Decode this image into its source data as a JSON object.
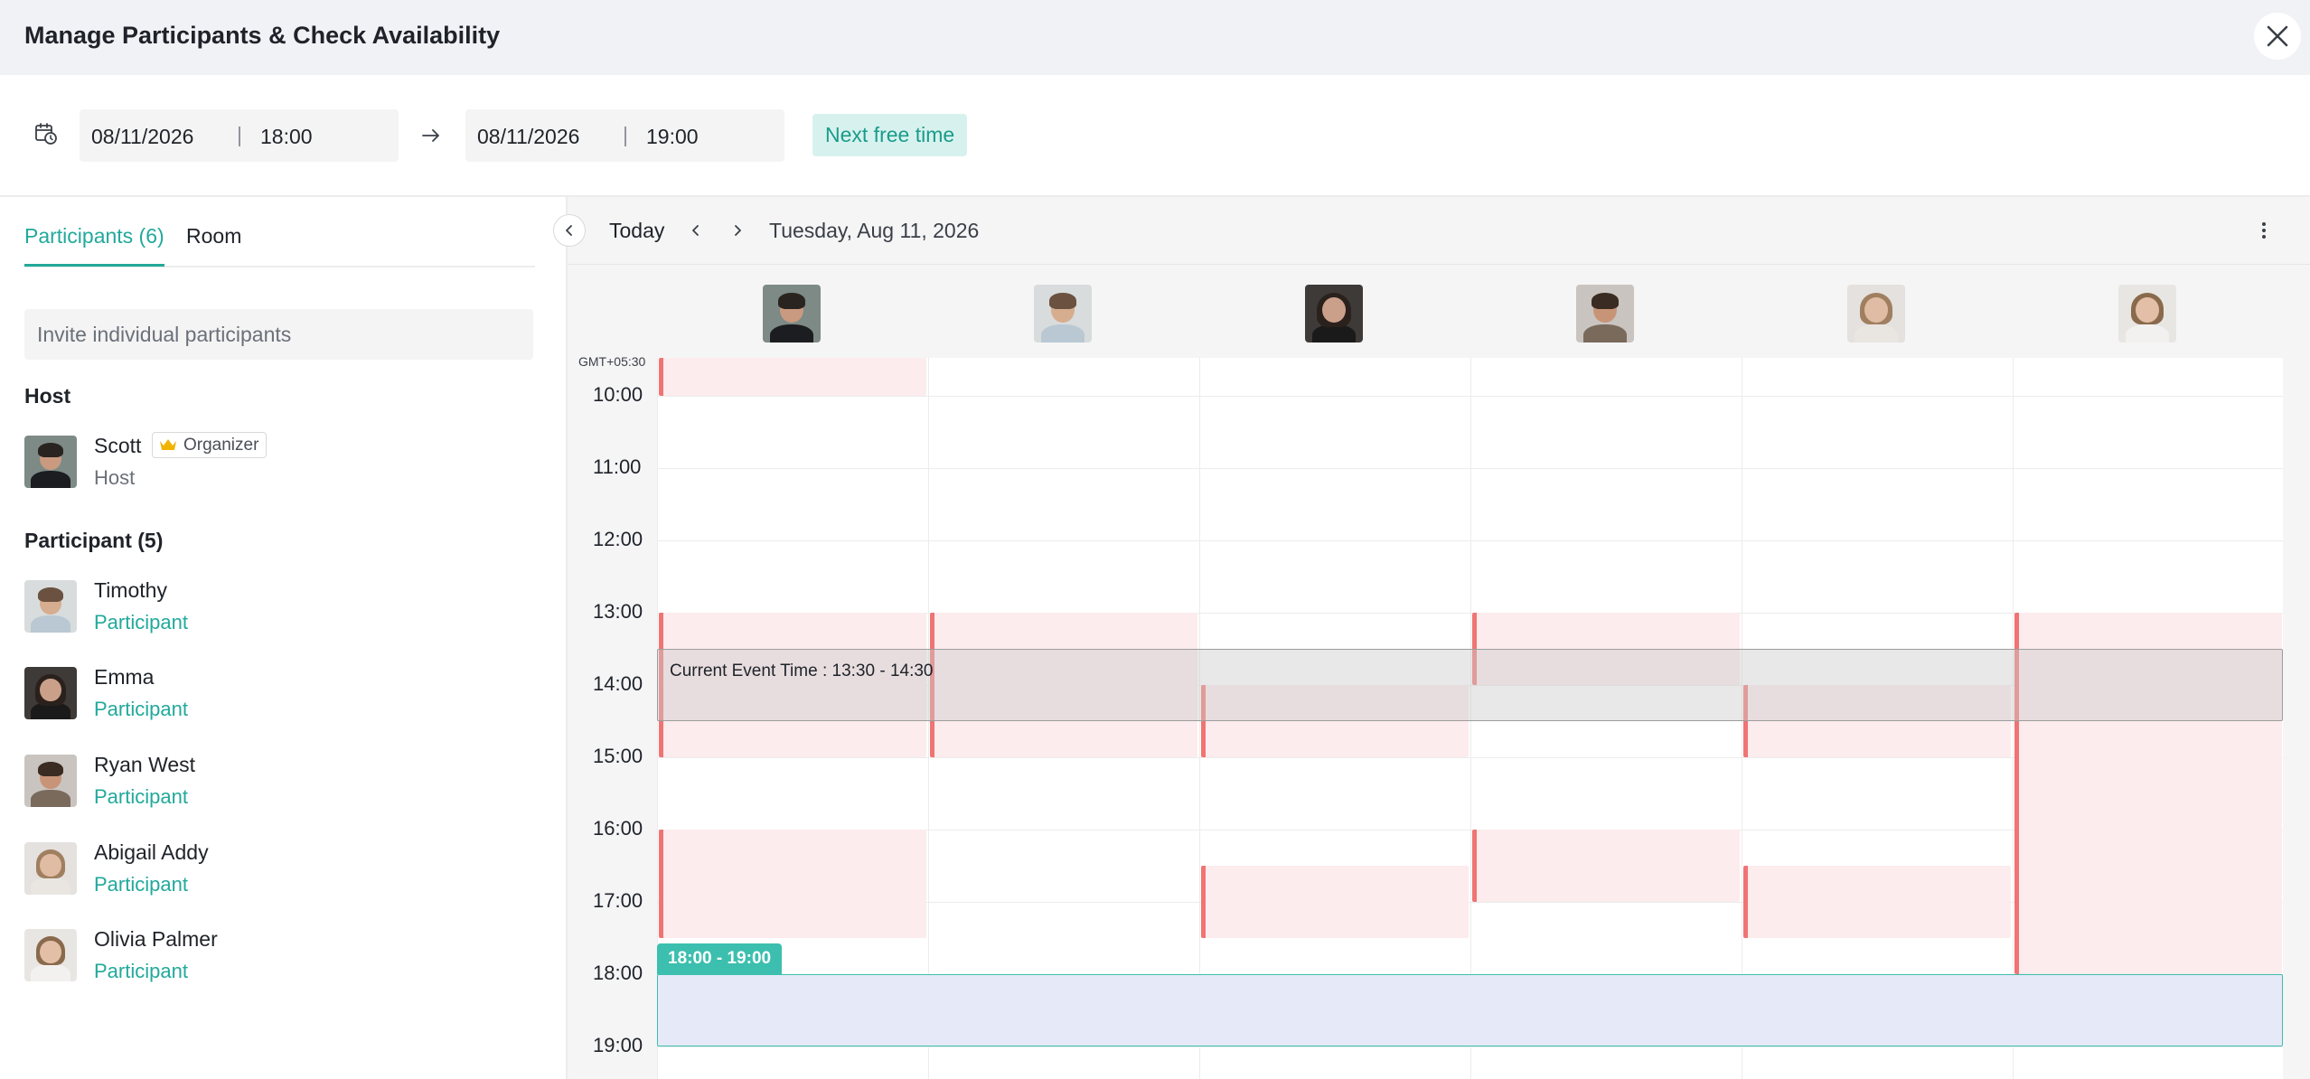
{
  "header": {
    "title": "Manage Participants & Check Availability"
  },
  "date_range": {
    "start_date": "08/11/2026",
    "start_time": "18:00",
    "end_date": "08/11/2026",
    "end_time": "19:00",
    "separator": "|",
    "next_free_label": "Next free time"
  },
  "tabs": {
    "participants_label": "Participants (6)",
    "room_label": "Room"
  },
  "invite": {
    "placeholder": "Invite individual participants"
  },
  "host_section": {
    "title": "Host",
    "name": "Scott",
    "badge": "Organizer",
    "role": "Host"
  },
  "participants_section": {
    "title": "Participant (5)",
    "people": [
      {
        "name": "Timothy",
        "role": "Participant"
      },
      {
        "name": "Emma",
        "role": "Participant"
      },
      {
        "name": "Ryan West",
        "role": "Participant"
      },
      {
        "name": "Abigail Addy",
        "role": "Participant"
      },
      {
        "name": "Olivia Palmer",
        "role": "Participant"
      }
    ]
  },
  "calendar": {
    "today_label": "Today",
    "date_label": "Tuesday, Aug 11, 2026",
    "timezone": "GMT+05:30",
    "times": [
      "10:00",
      "11:00",
      "12:00",
      "13:00",
      "14:00",
      "15:00",
      "16:00",
      "17:00",
      "18:00",
      "19:00"
    ],
    "current_event_label": "Current Event Time : 13:30 - 14:30",
    "selected_slot_label": "18:00 - 19:00"
  },
  "colors": {
    "accent": "#22a99b",
    "busy_fill": "#fdeced",
    "busy_bar": "#f07474",
    "selected_fill": "#e6eaf8"
  }
}
